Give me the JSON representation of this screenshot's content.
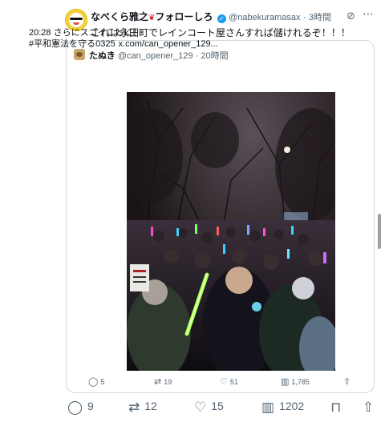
{
  "post": {
    "author_name": "なべくら雅之",
    "author_name_suffix": "フォローしろ",
    "handle": "@nabekuramasax",
    "dot": "·",
    "time": "3時間",
    "text": "これは永田町でレインコート屋さんすれば儲けれるぞ！！！",
    "icons": {
      "grok": "grok-icon",
      "more": "more-icon",
      "verified": "verified-icon",
      "rose": "rose-icon"
    }
  },
  "quote": {
    "author_name": "たぬき",
    "handle": "@can_opener_129",
    "dot": "·",
    "time": "20時間",
    "line1": "20:28 さらにスゴイことに！",
    "line2_text": "#平和憲法を守る0325",
    "line2_link": "x.com/can_opener_129...",
    "photo_description_icon": "protest-night-photo",
    "stats": {
      "replies": "5",
      "reposts": "19",
      "likes": "51",
      "views": "1,785"
    }
  },
  "actions": {
    "replies": "9",
    "reposts": "12",
    "likes": "15",
    "views": "1202"
  },
  "colors": {
    "accent": "#1d9bf0",
    "muted": "#536471",
    "border": "#cfd9de"
  }
}
